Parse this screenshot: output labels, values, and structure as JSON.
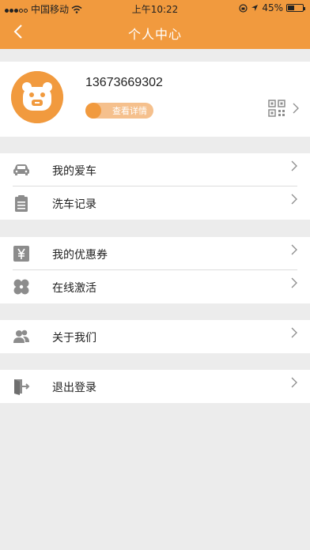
{
  "status_bar": {
    "carrier": "中国移动",
    "time": "上午10:22",
    "battery": "45%",
    "battery_level": 0.45
  },
  "nav": {
    "title": "个人中心",
    "back_icon": "chevron-left-icon"
  },
  "profile": {
    "phone": "13673669302",
    "details_label": "查看详情",
    "qr_icon": "qr-code-icon"
  },
  "menu_groups": [
    {
      "items": [
        {
          "label": "我的爱车",
          "icon": "car-icon"
        },
        {
          "label": "洗车记录",
          "icon": "clipboard-icon"
        }
      ]
    },
    {
      "items": [
        {
          "label": "我的优惠券",
          "icon": "yen-icon"
        },
        {
          "label": "在线激活",
          "icon": "clover-icon"
        }
      ]
    },
    {
      "items": [
        {
          "label": "关于我们",
          "icon": "users-icon"
        }
      ]
    },
    {
      "items": [
        {
          "label": "退出登录",
          "icon": "logout-icon"
        }
      ]
    }
  ],
  "colors": {
    "brand_orange": "#f19a3e",
    "light_orange": "#f5c08d",
    "icon_gray": "#8c8c8c",
    "background": "#ececec"
  }
}
